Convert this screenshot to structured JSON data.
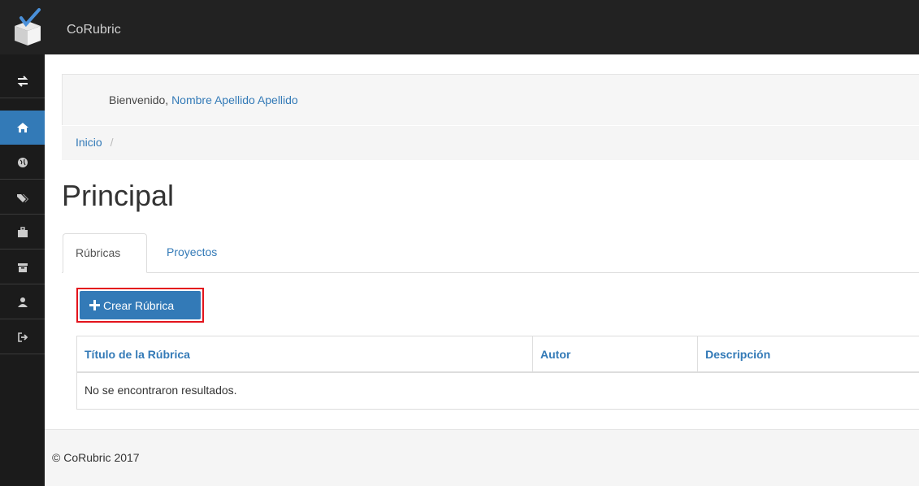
{
  "app": {
    "brand": "CoRubric"
  },
  "sidebar": {
    "items": [
      {
        "icon": "exchange-icon",
        "active": false
      },
      {
        "icon": "home-icon",
        "active": true
      },
      {
        "icon": "globe-icon",
        "active": false
      },
      {
        "icon": "tags-icon",
        "active": false
      },
      {
        "icon": "briefcase-icon",
        "active": false
      },
      {
        "icon": "archive-icon",
        "active": false
      },
      {
        "icon": "user-icon",
        "active": false
      },
      {
        "icon": "logout-icon",
        "active": false
      }
    ]
  },
  "welcome": {
    "prefix": "Bienvenido,",
    "user": "Nombre Apellido Apellido"
  },
  "breadcrumb": {
    "home": "Inicio",
    "separator": "/"
  },
  "page": {
    "title": "Principal"
  },
  "tabs": [
    {
      "label": "Rúbricas",
      "active": true
    },
    {
      "label": "Proyectos",
      "active": false
    }
  ],
  "actions": {
    "create_label": "Crear Rúbrica"
  },
  "table": {
    "headers": [
      "Título de la Rúbrica",
      "Autor",
      "Descripción"
    ],
    "empty_message": "No se encontraron resultados."
  },
  "footer": {
    "text": "© CoRubric 2017"
  },
  "colors": {
    "accent": "#337ab7",
    "topbar": "#222222",
    "highlight": "#e3141c"
  }
}
